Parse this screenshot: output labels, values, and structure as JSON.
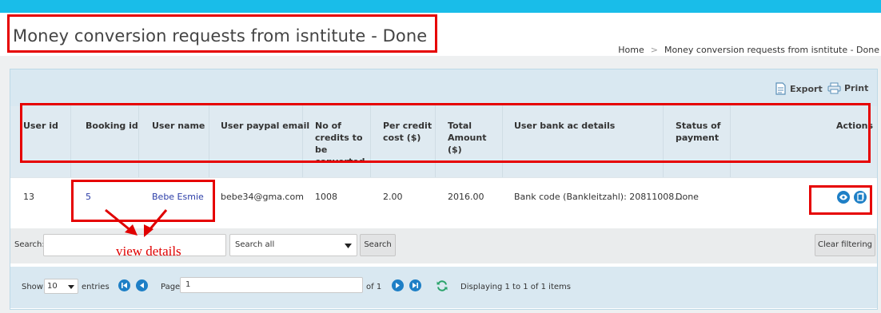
{
  "page": {
    "title": "Money conversion requests from isntitute - Done"
  },
  "breadcrumb": {
    "home": "Home",
    "separator": ">",
    "current": "Money conversion requests from isntitute - Done"
  },
  "toolbar": {
    "export_label": "Export",
    "print_label": "Print"
  },
  "table": {
    "headers": {
      "user_id": "User id",
      "booking_id": "Booking id",
      "user_name": "User name",
      "paypal_email": "User paypal email",
      "credits_l1": "No of",
      "credits_l2": "credits to",
      "credits_l3": "be",
      "credits_l4": "converted",
      "per_credit_l1": "Per credit",
      "per_credit_l2": "cost ($)",
      "total_l1": "Total",
      "total_l2": "Amount",
      "total_l3": "($)",
      "bank": "User bank ac details",
      "status_l1": "Status of",
      "status_l2": "payment",
      "actions": "Actions"
    },
    "rows": [
      {
        "user_id": "13",
        "booking_id": "5",
        "user_name": "Bebe Esmie",
        "paypal_email": "bebe34@gma.com",
        "credits": "1008",
        "per_credit": "2.00",
        "total": "2016.00",
        "bank": "Bank code (Bankleitzahl): 20811008...",
        "status": "Done"
      }
    ]
  },
  "search": {
    "label": "Search:",
    "value": "",
    "scope_selected": "Search all",
    "search_button": "Search",
    "clear_button": "Clear filtering"
  },
  "annotation": {
    "text": "view details"
  },
  "pager": {
    "show_label": "Show",
    "page_size": "10",
    "entries_label": "entries",
    "page_label": "Page",
    "page_value": "1",
    "of_label": "of 1",
    "display_text": "Displaying 1 to 1 of 1 items"
  },
  "colors": {
    "topbar": "#19bde9",
    "annotation_red": "#e60000",
    "action_blue": "#1e7fc6",
    "link_blue": "#2b3da7"
  },
  "icons": [
    "export-icon",
    "print-icon",
    "view-icon",
    "copy-icon",
    "first-page-icon",
    "prev-page-icon",
    "next-page-icon",
    "last-page-icon",
    "refresh-icon",
    "dropdown-caret-icon"
  ]
}
